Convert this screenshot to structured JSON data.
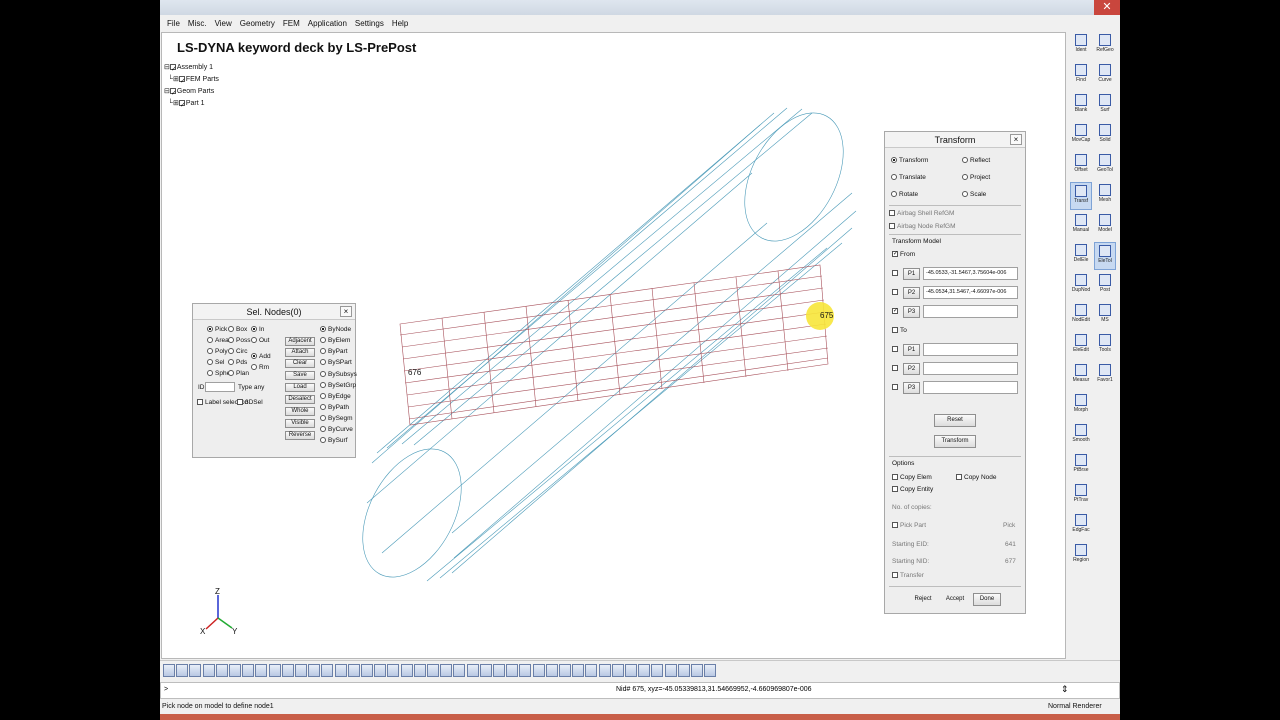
{
  "menu": [
    "File",
    "Misc.",
    "View",
    "Geometry",
    "FEM",
    "Application",
    "Settings",
    "Help"
  ],
  "viewport": {
    "title": "LS-DYNA keyword deck by LS-PrePost",
    "tree": [
      "Assembly 1",
      "FEM Parts",
      "Geom Parts",
      "Part 1"
    ],
    "node_labels": [
      "676",
      "675"
    ],
    "axes": {
      "z": "Z",
      "x": "X",
      "y": "Y"
    }
  },
  "right_toolbar": [
    [
      "Ident",
      "RefGeo"
    ],
    [
      "Find",
      "Curve"
    ],
    [
      "Blank",
      "Surf"
    ],
    [
      "MovCap",
      "Solid"
    ],
    [
      "Offset",
      "GeoTol"
    ],
    [
      "Transf",
      "Mesh"
    ],
    [
      "Manual",
      "Model"
    ],
    [
      "DelEle",
      "EleTol"
    ],
    [
      "DupNod",
      "Post"
    ],
    [
      "NodEdit",
      "MS"
    ],
    [
      "EleEdit",
      "Tools"
    ],
    [
      "Measur",
      "Favor1"
    ],
    [
      "Morph",
      ""
    ],
    [
      "Smooth",
      ""
    ],
    [
      "PtBrse",
      ""
    ],
    [
      "PtTrav",
      ""
    ],
    [
      "EdgFac",
      ""
    ],
    [
      "Region",
      ""
    ]
  ],
  "sel_nodes": {
    "title": "Sel. Nodes(0)",
    "col1": [
      "Pick",
      "Area",
      "Poly",
      "Sel",
      "Sphe"
    ],
    "col2": [
      "Box",
      "Poss",
      "Circ",
      "Pds",
      "Plan"
    ],
    "col3": [
      "In",
      "Out",
      "Add",
      "Rm"
    ],
    "buttons": [
      "Adjacent",
      "Attach",
      "Clear",
      "Save",
      "Load",
      "Desalect",
      "Whole",
      "Visible",
      "Reverse"
    ],
    "col5": [
      "ByNode",
      "ByElem",
      "ByPart",
      "BySPart",
      "BySubsys",
      "BySetGrp",
      "ByEdge",
      "ByPath",
      "BySegm",
      "ByCurve",
      "BySurf"
    ],
    "id_label": "ID",
    "type_label": "Type any",
    "label_selection": "Label selection",
    "dsel": "3DSel"
  },
  "transform": {
    "title": "Transform",
    "modes": [
      "Transform",
      "Reflect",
      "Translate",
      "Project",
      "Rotate",
      "Scale"
    ],
    "airbag_shell": "Airbag Shell RefGM",
    "airbag_node": "Airbag Node RefGM",
    "model_label": "Transform Model",
    "from_label": "From",
    "to_label": "To",
    "points": [
      "P1",
      "P2",
      "P3"
    ],
    "from_values": [
      "-45.0533,-31.5467,3.75604e-006",
      "-45.0534,31.5467,-4.66097e-006",
      ""
    ],
    "reset": "Reset",
    "transform_btn": "Transform",
    "options_label": "Options",
    "copy_elem": "Copy Elem",
    "copy_node": "Copy Node",
    "copy_entity": "Copy Entity",
    "no_copies": "No. of copies:",
    "pick_part": "Pick Part",
    "pick_label": "Pick",
    "starting_eid": "Starting EID:",
    "starting_eid_val": "641",
    "starting_nid": "Starting NID:",
    "starting_nid_val": "677",
    "transfer": "Transfer",
    "reject": "Reject",
    "accept": "Accept",
    "done": "Done"
  },
  "cmdline": {
    "prompt": ">",
    "pick_text": "Nid#    675, xyz=-45.05339813,31.54669952,-4.660969807e-006"
  },
  "status": {
    "left": "Pick node on model to define node1",
    "right": "Normal Renderer"
  }
}
